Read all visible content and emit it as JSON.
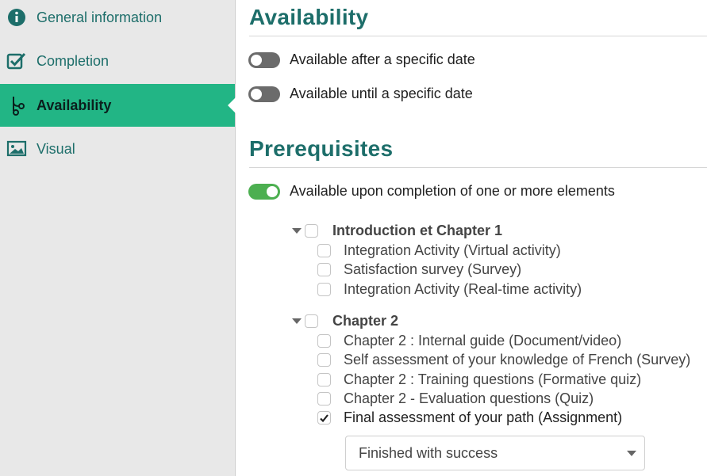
{
  "sidebar": {
    "items": [
      {
        "label": "General information",
        "icon": "info-icon"
      },
      {
        "label": "Completion",
        "icon": "checkbox-check-icon"
      },
      {
        "label": "Availability",
        "icon": "branch-icon",
        "active": true
      },
      {
        "label": "Visual",
        "icon": "image-icon"
      }
    ]
  },
  "availability": {
    "title": "Availability",
    "toggles": [
      {
        "label": "Available after a specific date",
        "on": false
      },
      {
        "label": "Available until a specific date",
        "on": false
      }
    ]
  },
  "prerequisites": {
    "title": "Prerequisites",
    "toggle": {
      "label": "Available upon completion of one or more elements",
      "on": true
    },
    "groups": [
      {
        "label": "Introduction et Chapter 1",
        "items": [
          {
            "label": "Integration Activity (Virtual activity)",
            "checked": false
          },
          {
            "label": "Satisfaction survey (Survey)",
            "checked": false
          },
          {
            "label": "Integration Activity (Real-time activity)",
            "checked": false
          }
        ]
      },
      {
        "label": "Chapter 2",
        "items": [
          {
            "label": "Chapter 2 : Internal guide (Document/video)",
            "checked": false
          },
          {
            "label": "Self assessment of your knowledge of French (Survey)",
            "checked": false
          },
          {
            "label": "Chapter 2 : Training questions (Formative quiz)",
            "checked": false
          },
          {
            "label": "Chapter 2 - Evaluation questions (Quiz)",
            "checked": false
          },
          {
            "label": "Final assessment of your path (Assignment)",
            "checked": true
          }
        ]
      }
    ],
    "condition_select": {
      "value": "Finished with success"
    }
  },
  "colors": {
    "accent": "#22b585",
    "title": "#1d6e6a",
    "toggle_on": "#4caf50",
    "toggle_off": "#6b6b6b"
  }
}
